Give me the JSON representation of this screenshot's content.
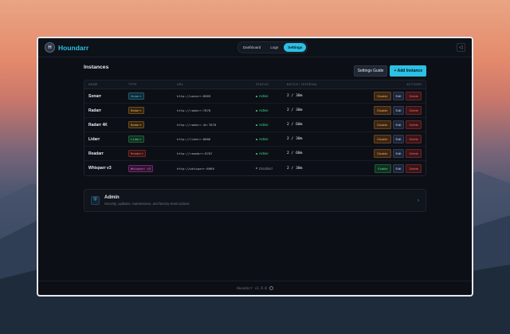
{
  "app": {
    "name": "Houndarr",
    "logo_text": "H"
  },
  "nav": {
    "items": [
      {
        "label": "Dashboard",
        "active": false
      },
      {
        "label": "Logs",
        "active": false
      },
      {
        "label": "Settings",
        "active": true
      }
    ]
  },
  "section": {
    "title": "Instances",
    "settings_guide": "Settings Guide",
    "add_instance": "+ Add Instance"
  },
  "table": {
    "headers": {
      "name": "NAME",
      "type": "TYPE",
      "url": "URL",
      "status": "STATUS",
      "batch": "BATCH / INTERVAL",
      "actions": "ACTIONS"
    },
    "rows": [
      {
        "name": "Sonarr",
        "type": "Sonarr",
        "url": "http://sonarr:8989",
        "status": "Active",
        "batch": "2 / 30m",
        "toggle": "Disable",
        "edit": "Edit",
        "delete": "Delete"
      },
      {
        "name": "Radarr",
        "type": "Radarr",
        "url": "http://radarr:7878",
        "status": "Active",
        "batch": "2 / 30m",
        "toggle": "Disable",
        "edit": "Edit",
        "delete": "Delete"
      },
      {
        "name": "Radarr 4K",
        "type": "Radarr",
        "url": "http://radarr-4k:7878",
        "status": "Active",
        "batch": "2 / 60m",
        "toggle": "Disable",
        "edit": "Edit",
        "delete": "Delete"
      },
      {
        "name": "Lidarr",
        "type": "Lidarr",
        "url": "http://lidarr:8686",
        "status": "Active",
        "batch": "2 / 30m",
        "toggle": "Disable",
        "edit": "Edit",
        "delete": "Delete"
      },
      {
        "name": "Readarr",
        "type": "Readarr",
        "url": "http://readarr:8787",
        "status": "Active",
        "batch": "2 / 60m",
        "toggle": "Disable",
        "edit": "Edit",
        "delete": "Delete"
      },
      {
        "name": "Whisparr v3",
        "type": "Whisparr v3",
        "url": "http://whisparr:6969",
        "status": "Disabled",
        "batch": "2 / 30m",
        "toggle": "Enable",
        "edit": "Edit",
        "delete": "Delete"
      }
    ]
  },
  "admin": {
    "title": "Admin",
    "subtitle": "Security, updates, maintenance, and factory-reset actions."
  },
  "footer": {
    "version": "Houndarr v1.9.0"
  },
  "colors": {
    "accent": "#2bc0e4",
    "active": "#3ddc84"
  }
}
